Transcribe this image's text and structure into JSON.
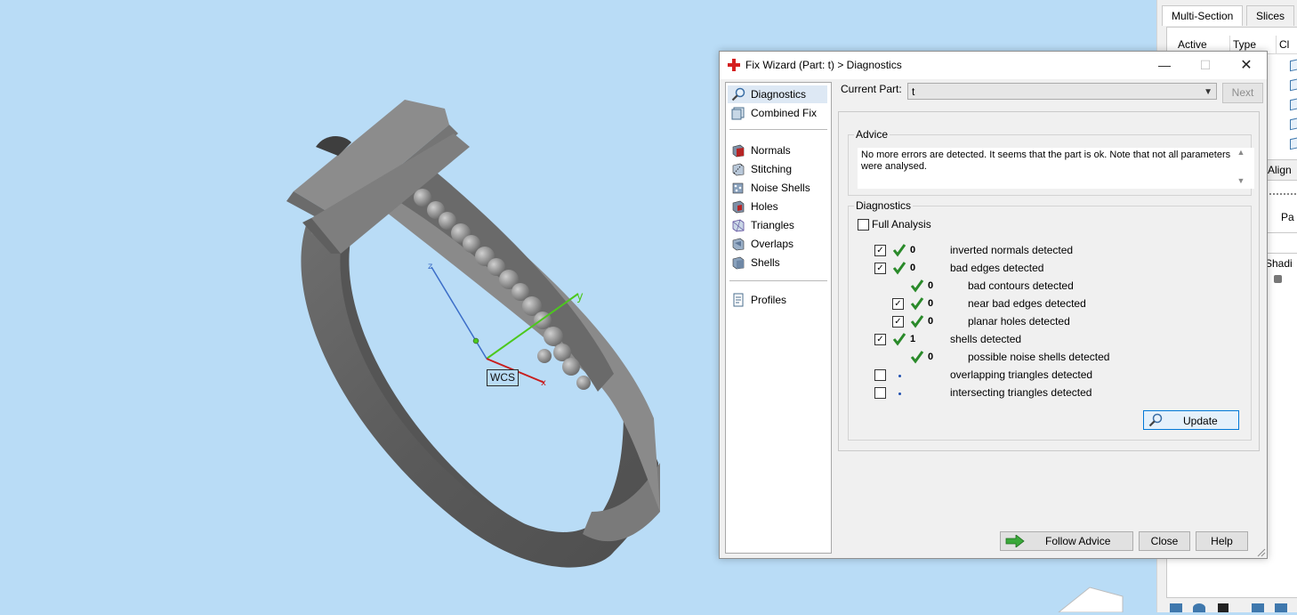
{
  "viewport": {
    "wcs_label": "WCS",
    "axis_labels": {
      "y": "y",
      "z": "z",
      "x": "x"
    },
    "colors": {
      "background": "#b9dcf6",
      "axis_x": "#c81e1e",
      "axis_y": "#4cc81e",
      "axis_z": "#3c6ec8"
    }
  },
  "side_panel": {
    "tabs": [
      "Multi-Section",
      "Slices"
    ],
    "columns": [
      "Active",
      "Type",
      "Cl"
    ],
    "align_label": "Align",
    "p_label": "P",
    "pa_label": "Pa",
    "shading_label": "Shadi"
  },
  "dialog": {
    "title": "Fix Wizard (Part: t) > Diagnostics",
    "window_buttons": {
      "minimize": "—",
      "maximize": "☐",
      "close": "✕"
    },
    "nav": [
      {
        "label": "Diagnostics",
        "icon": "magnifier-icon"
      },
      {
        "label": "Combined Fix",
        "icon": "combined-fix-icon"
      },
      {
        "label": "Normals",
        "icon": "normals-icon"
      },
      {
        "label": "Stitching",
        "icon": "stitching-icon"
      },
      {
        "label": "Noise Shells",
        "icon": "noise-shells-icon"
      },
      {
        "label": "Holes",
        "icon": "holes-icon"
      },
      {
        "label": "Triangles",
        "icon": "triangles-icon"
      },
      {
        "label": "Overlaps",
        "icon": "overlaps-icon"
      },
      {
        "label": "Shells",
        "icon": "shells-icon"
      },
      {
        "label": "Profiles",
        "icon": "profiles-icon"
      }
    ],
    "current_part_label": "Current Part:",
    "current_part_value": "t",
    "next_label": "Next",
    "advice": {
      "title": "Advice",
      "text": "No more errors are detected. It seems that the part is ok. Note that not all parameters were analysed."
    },
    "diagnostics": {
      "title": "Diagnostics",
      "full_analysis_label": "Full Analysis",
      "full_analysis_checked": false,
      "rows": [
        {
          "count": "0",
          "label": "inverted normals detected",
          "checked": true,
          "ok": true
        },
        {
          "count": "0",
          "label": "bad edges detected",
          "checked": true,
          "ok": true
        },
        {
          "count": "0",
          "label": "bad contours detected",
          "ok": true
        },
        {
          "count": "0",
          "label": "near bad edges detected",
          "checked": true,
          "ok": true
        },
        {
          "count": "0",
          "label": "planar holes detected",
          "checked": true,
          "ok": true
        },
        {
          "count": "1",
          "label": "shells detected",
          "checked": true,
          "ok": true
        },
        {
          "count": "0",
          "label": "possible noise shells detected",
          "ok": true
        },
        {
          "count": "",
          "label": "overlapping triangles detected",
          "checked": false,
          "ok": false
        },
        {
          "count": "",
          "label": "intersecting triangles detected",
          "checked": false,
          "ok": false
        }
      ]
    },
    "update_label": "Update",
    "buttons": {
      "follow_advice": "Follow Advice",
      "close": "Close",
      "help": "Help"
    }
  }
}
